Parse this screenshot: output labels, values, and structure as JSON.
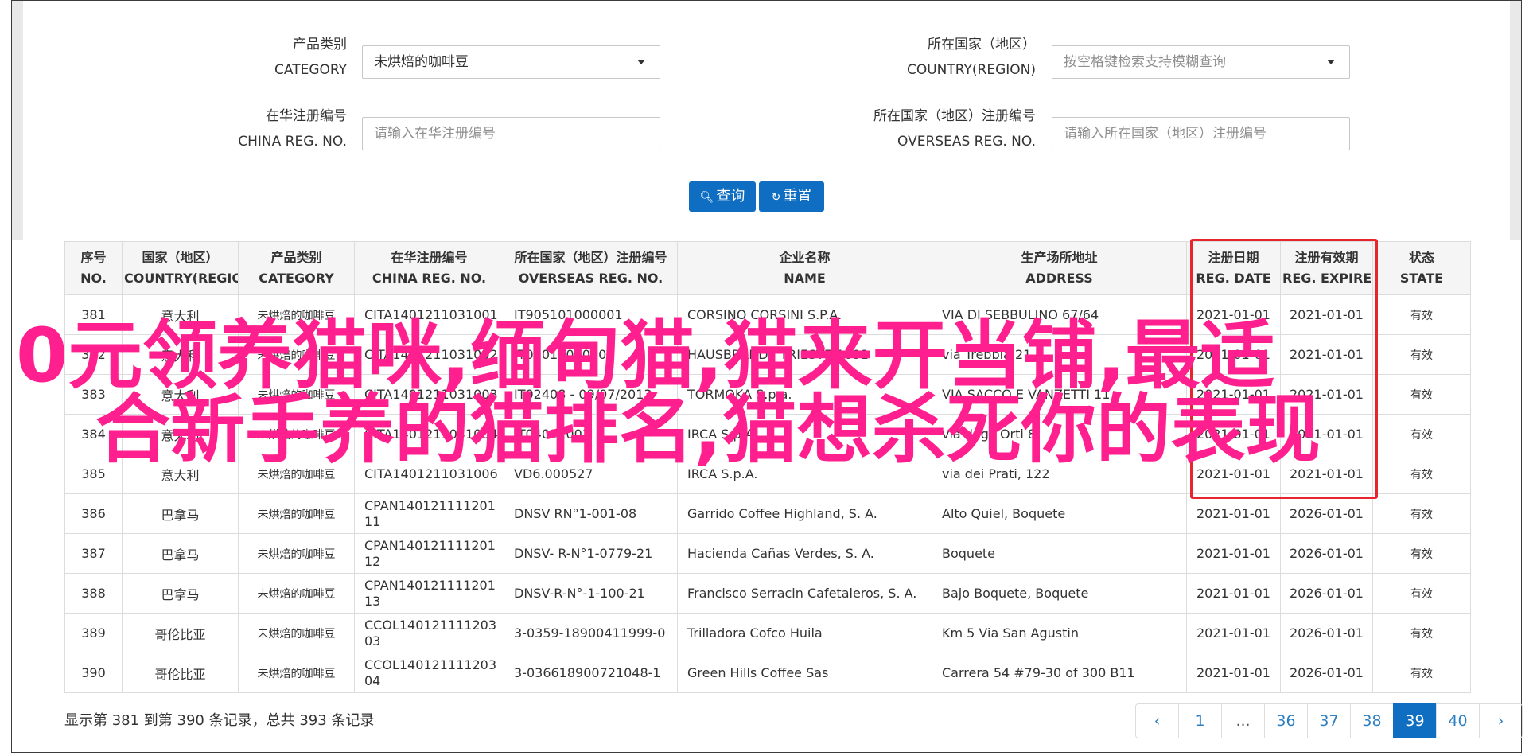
{
  "filters": {
    "category_label_cn": "产品类别",
    "category_label_en": "CATEGORY",
    "category_value": "未烘焙的咖啡豆",
    "country_label_cn": "所在国家（地区）",
    "country_label_en": "COUNTRY(REGION)",
    "country_placeholder": "按空格键检索支持模糊查询",
    "china_reg_label_cn": "在华注册编号",
    "china_reg_label_en": "CHINA REG. NO.",
    "china_reg_placeholder": "请输入在华注册编号",
    "overseas_reg_label_cn": "所在国家（地区）注册编号",
    "overseas_reg_label_en": "OVERSEAS REG. NO.",
    "overseas_reg_placeholder": "请输入所在国家（地区）注册编号",
    "search_button": "查询",
    "reset_button": "重置"
  },
  "table": {
    "headers": [
      {
        "cn": "序号",
        "en": "NO."
      },
      {
        "cn": "国家（地区）",
        "en": "COUNTRY(REGIO..."
      },
      {
        "cn": "产品类别",
        "en": "CATEGORY"
      },
      {
        "cn": "在华注册编号",
        "en": "CHINA REG. NO."
      },
      {
        "cn": "所在国家（地区）注册编号",
        "en": "OVERSEAS REG. NO."
      },
      {
        "cn": "企业名称",
        "en": "NAME"
      },
      {
        "cn": "生产场所地址",
        "en": "ADDRESS"
      },
      {
        "cn": "注册日期",
        "en": "REG. DATE"
      },
      {
        "cn": "注册有效期",
        "en": "REG. EXPIRE ..."
      },
      {
        "cn": "状态",
        "en": "STATE"
      }
    ],
    "rows": [
      {
        "no": "381",
        "country": "意大利",
        "category": "未烘焙的咖啡豆",
        "china_reg": "CITA1401211031001",
        "overseas_reg": "IT905101000001",
        "name": "CORSINO CORSINI S.P.A.",
        "address": "VIA DI SEBBULINO 67/64",
        "reg_date": "2021-01-01",
        "expire": "2021-01-01",
        "state": "有效"
      },
      {
        "no": "382",
        "country": "意大利",
        "category": "未烘焙的咖啡豆",
        "china_reg": "CITA1401211031002",
        "overseas_reg": "IT05011000001",
        "name": "HAUSBRANDT TRIESTE 1892",
        "address": "via Trebbia 21",
        "reg_date": "2021-01-01",
        "expire": "2021-01-01",
        "state": "有效"
      },
      {
        "no": "383",
        "country": "意大利",
        "category": "未烘焙的咖啡豆",
        "china_reg": "CITA1401211031003",
        "overseas_reg": "IT02408 - 09/07/2013",
        "name": "TORMOKA S.p.a.",
        "address": "VIA SACCO E VANZETTI 11",
        "reg_date": "2021-01-01",
        "expire": "2021-01-01",
        "state": "有效"
      },
      {
        "no": "384",
        "country": "意大利",
        "category": "未烘焙的咖啡豆",
        "china_reg": "CITA1401211031004",
        "overseas_reg": "IT04022001",
        "name": "IRCA S.p.A.",
        "address": "via degli Orti 8",
        "reg_date": "2021-01-01",
        "expire": "2021-01-01",
        "state": "有效"
      },
      {
        "no": "385",
        "country": "意大利",
        "category": "未烘焙的咖啡豆",
        "china_reg": "CITA1401211031006",
        "overseas_reg": "VD6.000527",
        "name": "IRCA S.p.A.",
        "address": "via dei Prati, 122",
        "reg_date": "2021-01-01",
        "expire": "2021-01-01",
        "state": "有效"
      },
      {
        "no": "386",
        "country": "巴拿马",
        "category": "未烘焙的咖啡豆",
        "china_reg": "CPAN14012111120111",
        "overseas_reg": "DNSV RN°1-001-08",
        "name": "Garrido Coffee Highland, S. A.",
        "address": "Alto Quiel, Boquete",
        "reg_date": "2021-01-01",
        "expire": "2026-01-01",
        "state": "有效"
      },
      {
        "no": "387",
        "country": "巴拿马",
        "category": "未烘焙的咖啡豆",
        "china_reg": "CPAN14012111120112",
        "overseas_reg": "DNSV- R-N°1-0779-21",
        "name": "Hacienda Cañas Verdes, S. A.",
        "address": "Boquete",
        "reg_date": "2021-01-01",
        "expire": "2026-01-01",
        "state": "有效"
      },
      {
        "no": "388",
        "country": "巴拿马",
        "category": "未烘焙的咖啡豆",
        "china_reg": "CPAN14012111120113",
        "overseas_reg": "DNSV-R-N°-1-100-21",
        "name": "Francisco Serracin Cafetaleros, S. A.",
        "address": "Bajo Boquete, Boquete",
        "reg_date": "2021-01-01",
        "expire": "2026-01-01",
        "state": "有效"
      },
      {
        "no": "389",
        "country": "哥伦比亚",
        "category": "未烘焙的咖啡豆",
        "china_reg": "CCOL14012111120303",
        "overseas_reg": "3-0359-18900411999-0",
        "name": "Trilladora Cofco Huila",
        "address": "Km 5 Via San Agustin",
        "reg_date": "2021-01-01",
        "expire": "2026-01-01",
        "state": "有效"
      },
      {
        "no": "390",
        "country": "哥伦比亚",
        "category": "未烘焙的咖啡豆",
        "china_reg": "CCOL14012111120304",
        "overseas_reg": "3-036618900721048-1",
        "name": "Green Hills Coffee Sas",
        "address": "Carrera 54 #79-30 of 300 B11",
        "reg_date": "2021-01-01",
        "expire": "2026-01-01",
        "state": "有效"
      }
    ]
  },
  "overlay": {
    "line1": "0元领养猫咪,缅甸猫,猫来开当铺,最适",
    "line2": "合新手养的猫排名,猫想杀死你的表现"
  },
  "footer": {
    "summary": "显示第 381 到第 390 条记录，总共 393 条记录"
  },
  "pagination": {
    "prev": "‹",
    "next": "›",
    "pages": [
      "1",
      "...",
      "36",
      "37",
      "38",
      "39",
      "40"
    ],
    "active": "39"
  },
  "colors": {
    "primary": "#0f6ec2",
    "highlight_box": "#e8242e",
    "overlay_text": "#ff1f8e"
  }
}
